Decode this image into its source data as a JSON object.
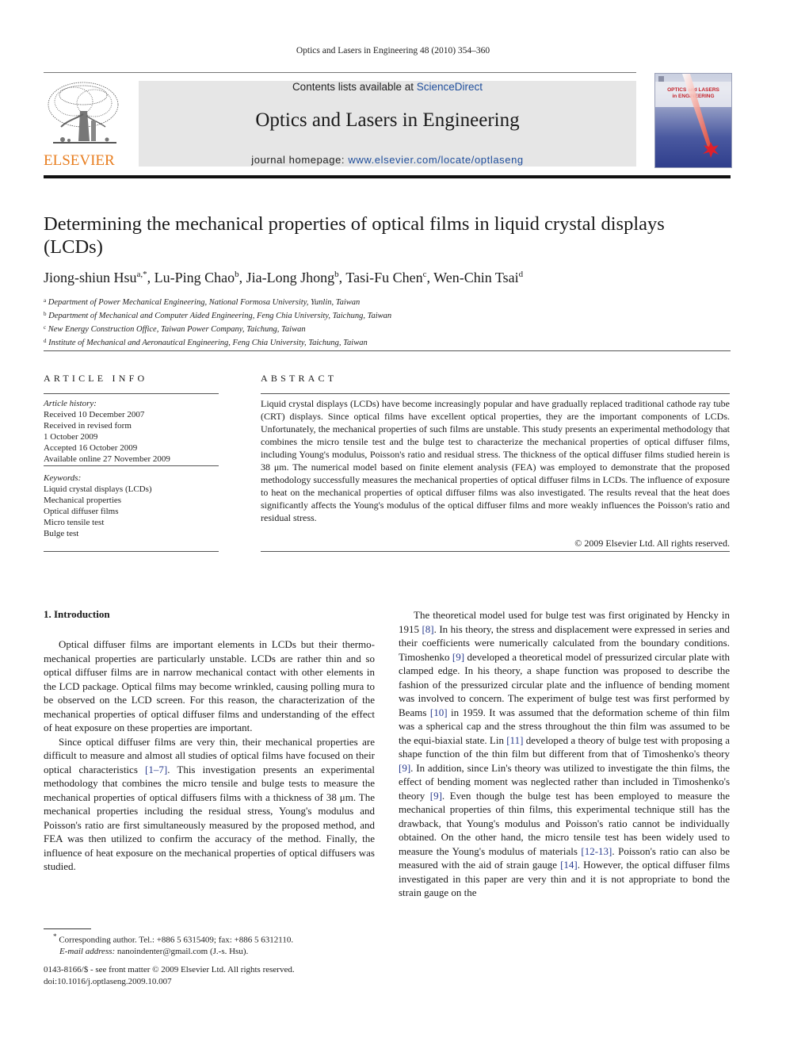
{
  "running_head": "Optics and Lasers in Engineering 48 (2010) 354–360",
  "header": {
    "publisher_wordmark": "ELSEVIER",
    "contents_prefix": "Contents lists available at ",
    "contents_link": "ScienceDirect",
    "journal_title": "Optics and Lasers in Engineering",
    "homepage_prefix": "journal homepage: ",
    "homepage_link": "www.elsevier.com/locate/optlaseng",
    "cover": {
      "title_line1": "OPTICS and LASERS",
      "title_line2": "in ENGINEERING"
    },
    "colors": {
      "publisher_orange": "#e87d1e",
      "link_blue": "#1f4e9c",
      "cover_red": "#c42027"
    }
  },
  "article": {
    "title": "Determining the mechanical properties of optical films in liquid crystal displays (LCDs)",
    "authors": [
      {
        "name": "Jiong-shiun Hsu",
        "sup": "a,*"
      },
      {
        "name": "Lu-Ping Chao",
        "sup": "b"
      },
      {
        "name": "Jia-Long Jhong",
        "sup": "b"
      },
      {
        "name": "Tasi-Fu Chen",
        "sup": "c"
      },
      {
        "name": "Wen-Chin Tsai",
        "sup": "d"
      }
    ],
    "affiliations": [
      {
        "key": "a",
        "text": "Department of Power Mechanical Engineering, National Formosa University, Yunlin, Taiwan"
      },
      {
        "key": "b",
        "text": "Department of Mechanical and Computer Aided Engineering, Feng Chia University, Taichung, Taiwan"
      },
      {
        "key": "c",
        "text": "New Energy Construction Office, Taiwan Power Company, Taichung, Taiwan"
      },
      {
        "key": "d",
        "text": "Institute of Mechanical and Aeronautical Engineering, Feng Chia University, Taichung, Taiwan"
      }
    ]
  },
  "article_info": {
    "heading": "ARTICLE INFO",
    "history_label": "Article history:",
    "history": [
      "Received 10 December 2007",
      "Received in revised form",
      "1 October 2009",
      "Accepted 16 October 2009",
      "Available online 27 November 2009"
    ],
    "keywords_label": "Keywords:",
    "keywords": [
      "Liquid crystal displays (LCDs)",
      "Mechanical properties",
      "Optical diffuser films",
      "Micro tensile test",
      "Bulge test"
    ]
  },
  "abstract": {
    "heading": "ABSTRACT",
    "text": "Liquid crystal displays (LCDs) have become increasingly popular and have gradually replaced traditional cathode ray tube (CRT) displays. Since optical films have excellent optical properties, they are the important components of LCDs. Unfortunately, the mechanical properties of such films are unstable. This study presents an experimental methodology that combines the micro tensile test and the bulge test to characterize the mechanical properties of optical diffuser films, including Young's modulus, Poisson's ratio and residual stress. The thickness of the optical diffuser films studied herein is 38 μm. The numerical model based on finite element analysis (FEA) was employed to demonstrate that the proposed methodology successfully measures the mechanical properties of optical diffuser films in LCDs. The influence of exposure to heat on the mechanical properties of optical diffuser films was also investigated. The results reveal that the heat does significantly affects the Young's modulus of the optical diffuser films and more weakly influences the Poisson's ratio and residual stress.",
    "copyright": "© 2009 Elsevier Ltd. All rights reserved."
  },
  "introduction": {
    "heading": "1.  Introduction",
    "left_paragraphs": [
      [
        {
          "t": "Optical diffuser films are important elements in LCDs but their thermo-mechanical properties are particularly unstable. LCDs are rather thin and so optical diffuser films are in narrow mechanical contact with other elements in the LCD package. Optical films may become wrinkled, causing polling mura to be observed on the LCD screen. For this reason, the characterization of the mechanical properties of optical diffuser films and understanding of the effect of heat exposure on these properties are important."
        }
      ],
      [
        {
          "t": "Since optical diffuser films are very thin, their mechanical properties are difficult to measure and almost all studies of optical films have focused on their optical characteristics "
        },
        {
          "ref": "[1–7]"
        },
        {
          "t": ". This investigation presents an experimental methodology that combines the micro tensile and bulge tests to measure the mechanical properties of optical diffusers films with a thickness of 38 μm. The mechanical properties including the residual stress, Young's modulus and Poisson's ratio are first simultaneously measured by the proposed method, and FEA was then utilized to confirm the accuracy of the method. Finally, the influence of heat exposure on the mechanical properties of optical diffusers was studied."
        }
      ]
    ],
    "right_paragraphs": [
      [
        {
          "t": "The theoretical model used for bulge test was first originated by Hencky in 1915 "
        },
        {
          "ref": "[8]"
        },
        {
          "t": ". In his theory, the stress and displacement were expressed in series and their coefficients were numerically calculated from the boundary conditions. Timoshenko "
        },
        {
          "ref": "[9]"
        },
        {
          "t": " developed a theoretical model of pressurized circular plate with clamped edge. In his theory, a shape function was proposed to describe the fashion of the pressurized circular plate and the influence of bending moment was involved to concern. The experiment of bulge test was first performed by Beams "
        },
        {
          "ref": "[10]"
        },
        {
          "t": " in 1959. It was assumed that the deformation scheme of thin film was a spherical cap and the stress throughout the thin film was assumed to be the equi-biaxial state. Lin "
        },
        {
          "ref": "[11]"
        },
        {
          "t": " developed a theory of bulge test with proposing a shape function of the thin film but different from that of Timoshenko's theory "
        },
        {
          "ref": "[9]"
        },
        {
          "t": ". In addition, since Lin's theory was utilized to investigate the thin films, the effect of bending moment was neglected rather than included in Timoshenko's theory "
        },
        {
          "ref": "[9]"
        },
        {
          "t": ". Even though the bulge test has been employed to measure the mechanical properties of thin films, this experimental technique still has the drawback, that Young's modulus and Poisson's ratio cannot be individually obtained. On the other hand, the micro tensile test has been widely used to measure the Young's modulus of materials "
        },
        {
          "ref": "[12-13]"
        },
        {
          "t": ". Poisson's ratio can also be measured with the aid of strain gauge "
        },
        {
          "ref": "[14]"
        },
        {
          "t": ". However, the optical diffuser films investigated in this paper are very thin and it is not appropriate to bond the strain gauge on the"
        }
      ]
    ]
  },
  "footnote": {
    "marker": "*",
    "corresponding": "Corresponding author. Tel.: +886 5 6315409; fax: +886 5 6312110.",
    "email_label": "E-mail address:",
    "email": "nanoindenter@gmail.com (J.-s. Hsu)."
  },
  "front_matter": {
    "issn_line": "0143-8166/$ - see front matter © 2009 Elsevier Ltd. All rights reserved.",
    "doi": "doi:10.1016/j.optlaseng.2009.10.007"
  }
}
